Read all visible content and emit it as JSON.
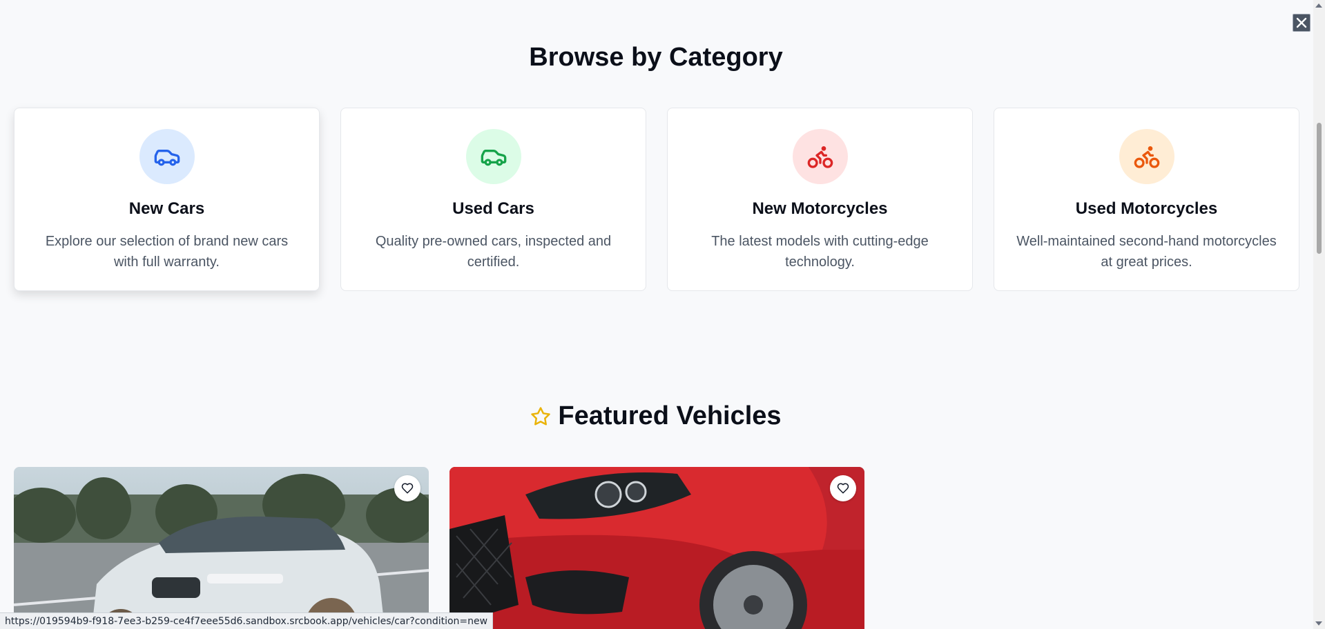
{
  "close_button": {
    "icon": "close-icon"
  },
  "browse": {
    "title": "Browse by Category",
    "categories": [
      {
        "title": "New Cars",
        "description": "Explore our selection of brand new cars with full warranty.",
        "icon": "car-icon",
        "icon_color": "#2563eb",
        "bg_color": "#dbeafe"
      },
      {
        "title": "Used Cars",
        "description": "Quality pre-owned cars, inspected and certified.",
        "icon": "car-icon",
        "icon_color": "#16a34a",
        "bg_color": "#dcfce7"
      },
      {
        "title": "New Motorcycles",
        "description": "The latest models with cutting-edge technology.",
        "icon": "motorcycle-icon",
        "icon_color": "#dc2626",
        "bg_color": "#fee2e2"
      },
      {
        "title": "Used Motorcycles",
        "description": "Well-maintained second-hand motorcycles at great prices.",
        "icon": "motorcycle-icon",
        "icon_color": "#ea580c",
        "bg_color": "#ffedd5"
      }
    ]
  },
  "featured": {
    "title": "Featured Vehicles",
    "icon": "star-icon",
    "icon_color": "#eab308",
    "vehicles": [
      {
        "image": "white-sedan-photo",
        "favorite_icon": "heart-icon"
      },
      {
        "image": "red-hatchback-photo",
        "favorite_icon": "heart-icon"
      }
    ]
  },
  "status_bar": {
    "url": "https://019594b9-f918-7ee3-b259-ce4f7eee55d6.sandbox.srcbook.app/vehicles/car?condition=new"
  }
}
